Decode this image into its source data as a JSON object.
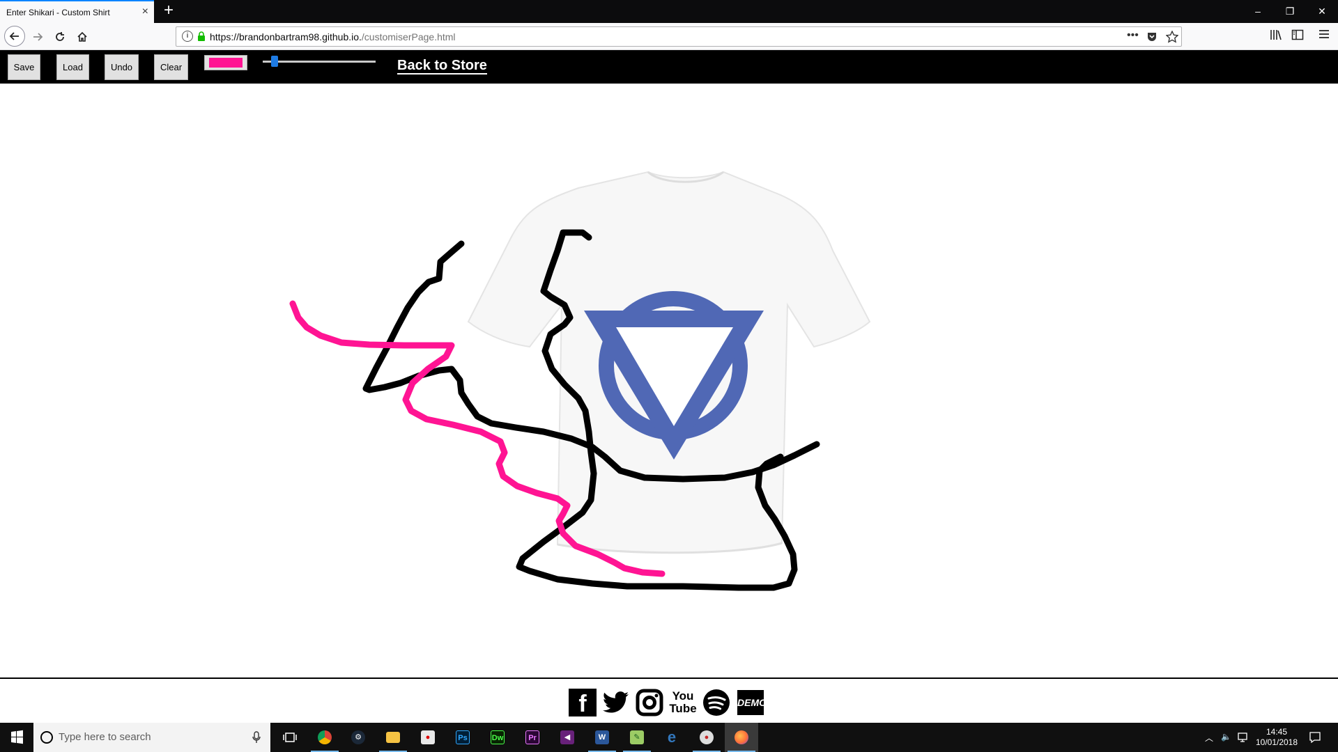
{
  "browser": {
    "tab_title": "Enter Shikari - Custom Shirt",
    "tab_close": "×",
    "new_tab": "+",
    "url_host": "https://brandonbartram98.github.io.",
    "url_path": "/customiserPage.html",
    "page_actions": "•••"
  },
  "window": {
    "minimize": "–",
    "restore": "❐",
    "close": "✕"
  },
  "toolbar": {
    "save": "Save",
    "load": "Load",
    "undo": "Undo",
    "clear": "Clear",
    "brush_color": "#ff1493",
    "brush_size_fraction": 0.08,
    "back_to_store": "Back to Store"
  },
  "canvas": {
    "shirt_color": "#ffffff",
    "logo_color": "#5068b5",
    "stroke_colors": [
      "#000000",
      "#ff1493"
    ]
  },
  "footer": {
    "social": [
      {
        "name": "facebook-icon",
        "glyph": "f"
      },
      {
        "name": "twitter-icon",
        "glyph": "🐦"
      },
      {
        "name": "instagram-icon",
        "glyph": "◎"
      },
      {
        "name": "youtube-icon",
        "glyph": "You Tube"
      },
      {
        "name": "spotify-icon",
        "glyph": "≋"
      },
      {
        "name": "demo-icon",
        "glyph": "DEMO"
      }
    ]
  },
  "taskbar": {
    "search_placeholder": "Type here to search",
    "time": "14:45",
    "date": "10/01/2018"
  }
}
